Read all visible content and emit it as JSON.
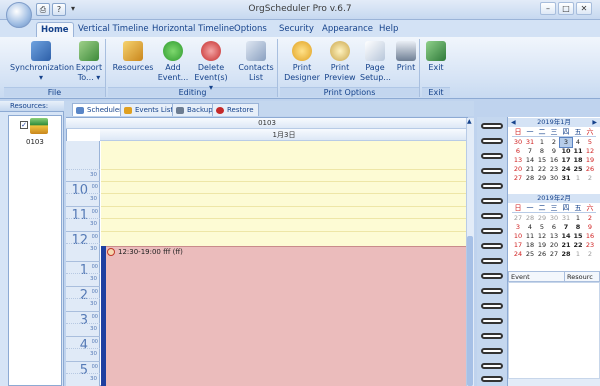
{
  "window": {
    "title": "OrgScheduler Pro v.6.7"
  },
  "tabs": [
    "Home",
    "Vertical Timeline",
    "Horizontal Timeline",
    "Options",
    "Security",
    "Appearance",
    "Help"
  ],
  "ribbon": {
    "file": {
      "label": "File",
      "sync": "Synchronization",
      "sync2": "▾",
      "export": "Export",
      "export2": "To... ▾"
    },
    "editing": {
      "label": "Editing",
      "resources": "Resources",
      "add": "Add",
      "add2": "Event...",
      "delete": "Delete",
      "delete2": "Event(s) ▾",
      "contacts": "Contacts",
      "contacts2": "List"
    },
    "print": {
      "label": "Print Options",
      "designer": "Print",
      "designer2": "Designer",
      "preview": "Print",
      "preview2": "Preview",
      "setup": "Page",
      "setup2": "Setup...",
      "print": "Print"
    },
    "exit": {
      "label": "Exit",
      "exit": "Exit"
    }
  },
  "resources": {
    "label": "Resources:",
    "item": "0103"
  },
  "subtabs": [
    "Scheduler",
    "Events List",
    "Backup",
    "Restore"
  ],
  "scheduler": {
    "resource": "0103",
    "date": "1月3日",
    "hours": [
      {
        "h": "10",
        "m": "00"
      },
      {
        "h": "11",
        "m": "00"
      },
      {
        "h": "12",
        "m": "00"
      },
      {
        "h": "1",
        "m": "00"
      },
      {
        "h": "2",
        "m": "00"
      },
      {
        "h": "3",
        "m": "00"
      },
      {
        "h": "4",
        "m": "00"
      },
      {
        "h": "5",
        "m": "00"
      }
    ],
    "half": "30",
    "appointment": "12:30-19:00 fff (ff)"
  },
  "calendar1": {
    "title": "2019年1月",
    "dow": [
      "日",
      "一",
      "二",
      "三",
      "四",
      "五",
      "六"
    ],
    "weeks": [
      [
        "30",
        "31",
        "1",
        "2",
        "3",
        "4",
        "5"
      ],
      [
        "6",
        "7",
        "8",
        "9",
        "10",
        "11",
        "12"
      ],
      [
        "13",
        "14",
        "15",
        "16",
        "17",
        "18",
        "19"
      ],
      [
        "20",
        "21",
        "22",
        "23",
        "24",
        "25",
        "26"
      ],
      [
        "27",
        "28",
        "29",
        "30",
        "31",
        "1",
        "2"
      ]
    ]
  },
  "calendar2": {
    "title": "2019年2月",
    "dow": [
      "日",
      "一",
      "二",
      "三",
      "四",
      "五",
      "六"
    ],
    "weeks": [
      [
        "27",
        "28",
        "29",
        "30",
        "31",
        "1",
        "2"
      ],
      [
        "3",
        "4",
        "5",
        "6",
        "7",
        "8",
        "9"
      ],
      [
        "10",
        "11",
        "12",
        "13",
        "14",
        "15",
        "16"
      ],
      [
        "17",
        "18",
        "19",
        "20",
        "21",
        "22",
        "23"
      ],
      [
        "24",
        "25",
        "26",
        "27",
        "28",
        "1",
        "2"
      ]
    ]
  },
  "events": {
    "col1": "Event",
    "col2": "Resourc"
  }
}
